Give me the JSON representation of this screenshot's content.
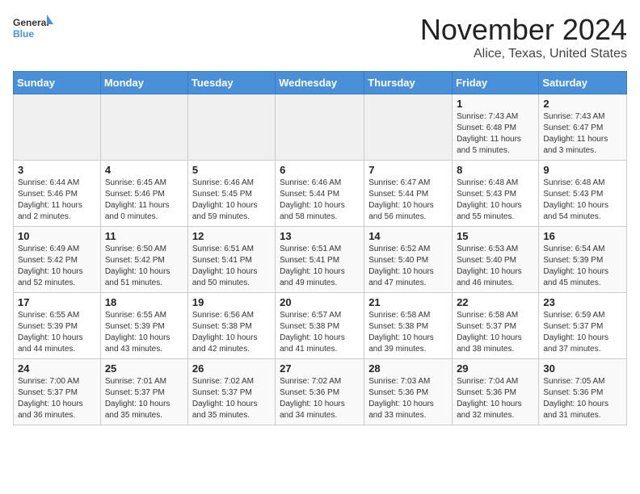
{
  "logo": {
    "text1": "General",
    "text2": "Blue"
  },
  "header": {
    "month": "November 2024",
    "location": "Alice, Texas, United States"
  },
  "weekdays": [
    "Sunday",
    "Monday",
    "Tuesday",
    "Wednesday",
    "Thursday",
    "Friday",
    "Saturday"
  ],
  "weeks": [
    [
      {
        "day": "",
        "info": ""
      },
      {
        "day": "",
        "info": ""
      },
      {
        "day": "",
        "info": ""
      },
      {
        "day": "",
        "info": ""
      },
      {
        "day": "",
        "info": ""
      },
      {
        "day": "1",
        "info": "Sunrise: 7:43 AM\nSunset: 6:48 PM\nDaylight: 11 hours\nand 5 minutes."
      },
      {
        "day": "2",
        "info": "Sunrise: 7:43 AM\nSunset: 6:47 PM\nDaylight: 11 hours\nand 3 minutes."
      }
    ],
    [
      {
        "day": "3",
        "info": "Sunrise: 6:44 AM\nSunset: 5:46 PM\nDaylight: 11 hours\nand 2 minutes."
      },
      {
        "day": "4",
        "info": "Sunrise: 6:45 AM\nSunset: 5:46 PM\nDaylight: 11 hours\nand 0 minutes."
      },
      {
        "day": "5",
        "info": "Sunrise: 6:46 AM\nSunset: 5:45 PM\nDaylight: 10 hours\nand 59 minutes."
      },
      {
        "day": "6",
        "info": "Sunrise: 6:46 AM\nSunset: 5:44 PM\nDaylight: 10 hours\nand 58 minutes."
      },
      {
        "day": "7",
        "info": "Sunrise: 6:47 AM\nSunset: 5:44 PM\nDaylight: 10 hours\nand 56 minutes."
      },
      {
        "day": "8",
        "info": "Sunrise: 6:48 AM\nSunset: 5:43 PM\nDaylight: 10 hours\nand 55 minutes."
      },
      {
        "day": "9",
        "info": "Sunrise: 6:48 AM\nSunset: 5:43 PM\nDaylight: 10 hours\nand 54 minutes."
      }
    ],
    [
      {
        "day": "10",
        "info": "Sunrise: 6:49 AM\nSunset: 5:42 PM\nDaylight: 10 hours\nand 52 minutes."
      },
      {
        "day": "11",
        "info": "Sunrise: 6:50 AM\nSunset: 5:42 PM\nDaylight: 10 hours\nand 51 minutes."
      },
      {
        "day": "12",
        "info": "Sunrise: 6:51 AM\nSunset: 5:41 PM\nDaylight: 10 hours\nand 50 minutes."
      },
      {
        "day": "13",
        "info": "Sunrise: 6:51 AM\nSunset: 5:41 PM\nDaylight: 10 hours\nand 49 minutes."
      },
      {
        "day": "14",
        "info": "Sunrise: 6:52 AM\nSunset: 5:40 PM\nDaylight: 10 hours\nand 47 minutes."
      },
      {
        "day": "15",
        "info": "Sunrise: 6:53 AM\nSunset: 5:40 PM\nDaylight: 10 hours\nand 46 minutes."
      },
      {
        "day": "16",
        "info": "Sunrise: 6:54 AM\nSunset: 5:39 PM\nDaylight: 10 hours\nand 45 minutes."
      }
    ],
    [
      {
        "day": "17",
        "info": "Sunrise: 6:55 AM\nSunset: 5:39 PM\nDaylight: 10 hours\nand 44 minutes."
      },
      {
        "day": "18",
        "info": "Sunrise: 6:55 AM\nSunset: 5:39 PM\nDaylight: 10 hours\nand 43 minutes."
      },
      {
        "day": "19",
        "info": "Sunrise: 6:56 AM\nSunset: 5:38 PM\nDaylight: 10 hours\nand 42 minutes."
      },
      {
        "day": "20",
        "info": "Sunrise: 6:57 AM\nSunset: 5:38 PM\nDaylight: 10 hours\nand 41 minutes."
      },
      {
        "day": "21",
        "info": "Sunrise: 6:58 AM\nSunset: 5:38 PM\nDaylight: 10 hours\nand 39 minutes."
      },
      {
        "day": "22",
        "info": "Sunrise: 6:58 AM\nSunset: 5:37 PM\nDaylight: 10 hours\nand 38 minutes."
      },
      {
        "day": "23",
        "info": "Sunrise: 6:59 AM\nSunset: 5:37 PM\nDaylight: 10 hours\nand 37 minutes."
      }
    ],
    [
      {
        "day": "24",
        "info": "Sunrise: 7:00 AM\nSunset: 5:37 PM\nDaylight: 10 hours\nand 36 minutes."
      },
      {
        "day": "25",
        "info": "Sunrise: 7:01 AM\nSunset: 5:37 PM\nDaylight: 10 hours\nand 35 minutes."
      },
      {
        "day": "26",
        "info": "Sunrise: 7:02 AM\nSunset: 5:37 PM\nDaylight: 10 hours\nand 35 minutes."
      },
      {
        "day": "27",
        "info": "Sunrise: 7:02 AM\nSunset: 5:36 PM\nDaylight: 10 hours\nand 34 minutes."
      },
      {
        "day": "28",
        "info": "Sunrise: 7:03 AM\nSunset: 5:36 PM\nDaylight: 10 hours\nand 33 minutes."
      },
      {
        "day": "29",
        "info": "Sunrise: 7:04 AM\nSunset: 5:36 PM\nDaylight: 10 hours\nand 32 minutes."
      },
      {
        "day": "30",
        "info": "Sunrise: 7:05 AM\nSunset: 5:36 PM\nDaylight: 10 hours\nand 31 minutes."
      }
    ]
  ]
}
